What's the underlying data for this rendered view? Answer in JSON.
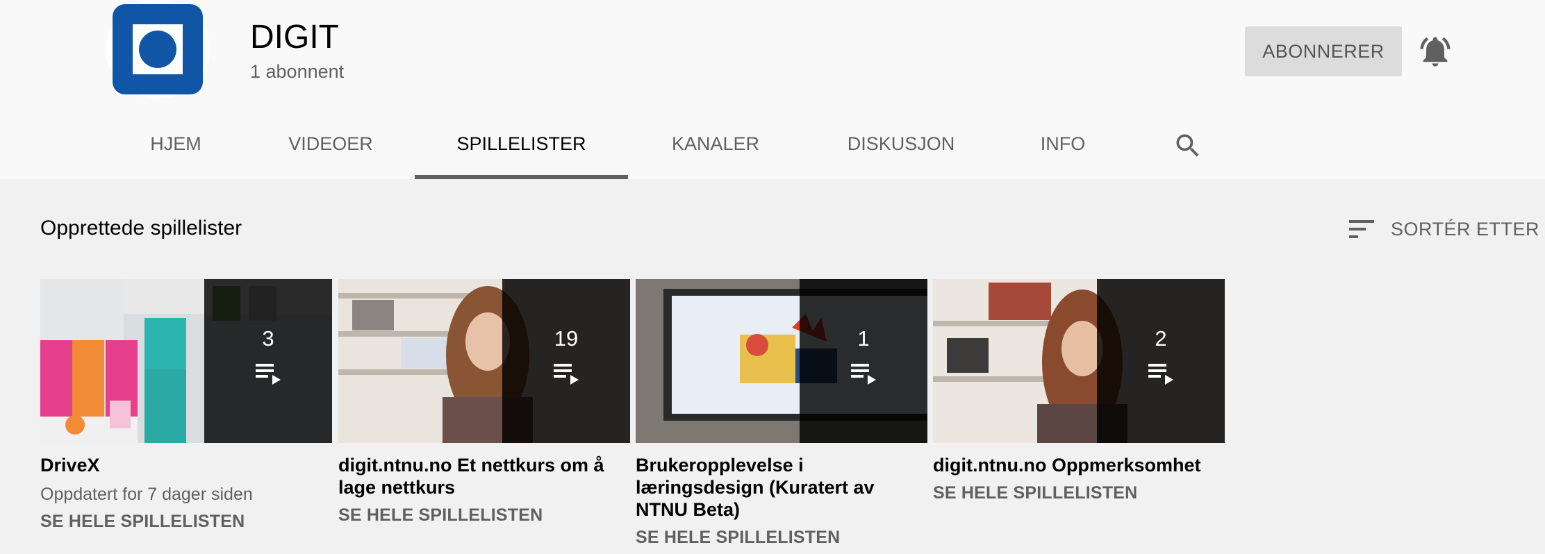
{
  "channel": {
    "name": "DIGIT",
    "subscribers": "1 abonnent",
    "subscribe_label": "ABONNERER",
    "notify_icon": "bell-icon"
  },
  "tabs": [
    {
      "label": "HJEM"
    },
    {
      "label": "VIDEOER"
    },
    {
      "label": "SPILLELISTER",
      "active": true
    },
    {
      "label": "KANALER"
    },
    {
      "label": "DISKUSJON"
    },
    {
      "label": "INFO"
    }
  ],
  "search_icon": "search-icon",
  "section": {
    "title": "Opprettede spillelister",
    "sort_label": "SORTÉR ETTER"
  },
  "playlists": [
    {
      "title": "DriveX",
      "count": "3",
      "meta": "Oppdatert for 7 dager siden",
      "link": "SE HELE SPILLELISTEN"
    },
    {
      "title": "digit.ntnu.no Et nettkurs om å lage nettkurs",
      "count": "19",
      "link": "SE HELE SPILLELISTEN"
    },
    {
      "title": "Brukeropplevelse i læringsdesign (Kuratert av NTNU Beta)",
      "count": "1",
      "link": "SE HELE SPILLELISTEN"
    },
    {
      "title": "digit.ntnu.no Oppmerksomhet",
      "count": "2",
      "link": "SE HELE SPILLELISTEN"
    }
  ],
  "colors": {
    "brand_blue": "#1156a6",
    "active_tab_indicator": "#606060",
    "subscribe_bg": "#dcdcdc"
  }
}
